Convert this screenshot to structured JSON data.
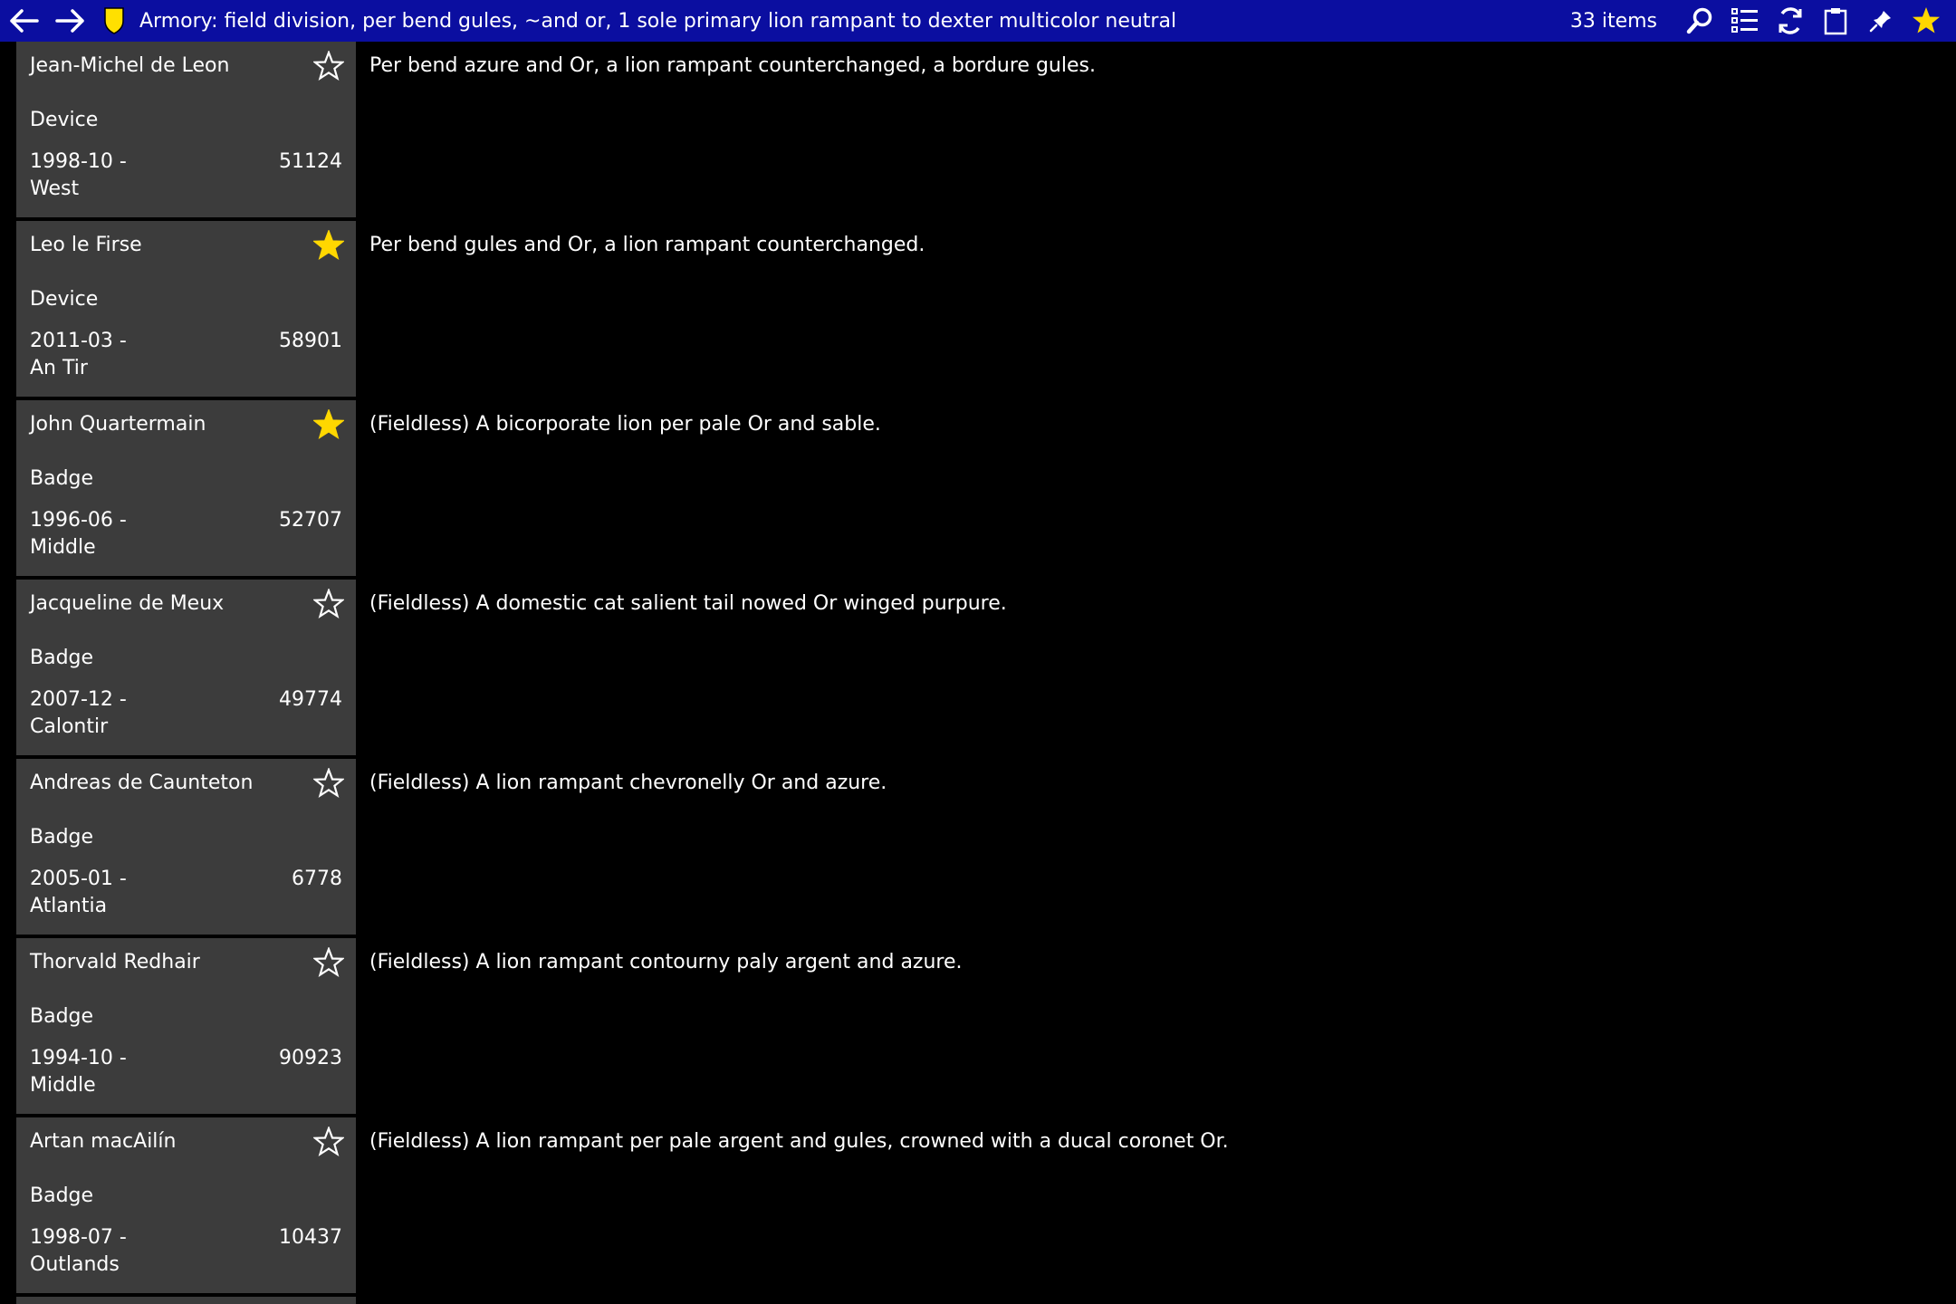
{
  "header": {
    "title": "Armory: field division, per bend gules, ~and or, 1 sole primary lion rampant to dexter multicolor neutral",
    "item_count": "33 items",
    "bar_color": "#0b0ea0",
    "icons": [
      "back-arrow-icon",
      "forward-arrow-icon",
      "shield-icon",
      "search-icon",
      "list-icon",
      "refresh-icon",
      "clipboard-icon",
      "pin-icon",
      "favorite-star-icon"
    ]
  },
  "colors": {
    "card_bg": "#3c3c3c",
    "star_filled": "#ffd700"
  },
  "items": [
    {
      "name": "Jean-Michel de Leon",
      "type": "Device",
      "date": "1998-10 -",
      "kingdom": "West",
      "number": "51124",
      "favorite": false,
      "blazon": "Per bend azure and Or, a lion rampant counterchanged, a bordure gules."
    },
    {
      "name": "Leo le Firse",
      "type": "Device",
      "date": "2011-03 -",
      "kingdom": "An Tir",
      "number": "58901",
      "favorite": true,
      "blazon": "Per bend gules and Or, a lion rampant counterchanged."
    },
    {
      "name": "John Quartermain",
      "type": "Badge",
      "date": "1996-06 -",
      "kingdom": "Middle",
      "number": "52707",
      "favorite": true,
      "blazon": "(Fieldless) A bicorporate lion per pale Or and sable."
    },
    {
      "name": "Jacqueline de Meux",
      "type": "Badge",
      "date": "2007-12 -",
      "kingdom": "Calontir",
      "number": "49774",
      "favorite": false,
      "blazon": "(Fieldless) A domestic cat salient tail nowed Or winged purpure."
    },
    {
      "name": "Andreas de Caunteton",
      "type": "Badge",
      "date": "2005-01 -",
      "kingdom": "Atlantia",
      "number": "6778",
      "favorite": false,
      "blazon": "(Fieldless) A lion rampant chevronelly Or and azure."
    },
    {
      "name": "Thorvald Redhair",
      "type": "Badge",
      "date": "1994-10 -",
      "kingdom": "Middle",
      "number": "90923",
      "favorite": false,
      "blazon": "(Fieldless) A lion rampant contourny paly argent and azure."
    },
    {
      "name": "Artan macAilín",
      "type": "Badge",
      "date": "1998-07 -",
      "kingdom": "Outlands",
      "number": "10437",
      "favorite": false,
      "blazon": "(Fieldless) A lion rampant per pale argent and gules, crowned with a ducal coronet Or."
    }
  ]
}
